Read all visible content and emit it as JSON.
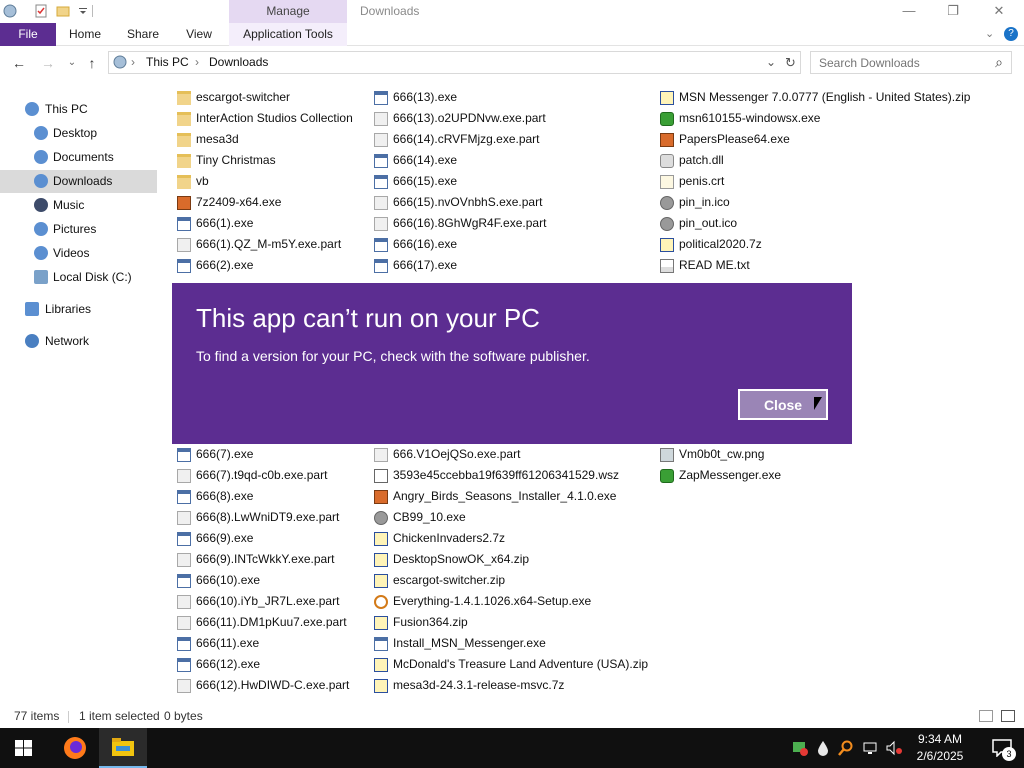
{
  "window": {
    "title": "Downloads",
    "manage_tab": "Manage",
    "minimize_glyph": "—",
    "maximize_glyph": "❐",
    "close_glyph": "✕"
  },
  "ribbon": {
    "file": "File",
    "home": "Home",
    "share": "Share",
    "view": "View",
    "app_tools": "Application Tools",
    "collapse_glyph": "⌄",
    "help_glyph": "?"
  },
  "address": {
    "back_glyph": "←",
    "forward_glyph": "→",
    "recent_glyph": "⌄",
    "up_glyph": "↑",
    "crumbs": [
      "This PC",
      "Downloads"
    ],
    "separator": "›",
    "dropdown_glyph": "⌄",
    "refresh_glyph": "↻",
    "search_placeholder": "Search Downloads",
    "search_glyph": "⌕"
  },
  "nav": {
    "items": [
      {
        "label": "This PC",
        "icon": "this-pc-icon",
        "color": "#5b8fd1"
      },
      {
        "label": "Desktop",
        "icon": "desktop-icon",
        "color": "#5b8fd1"
      },
      {
        "label": "Documents",
        "icon": "documents-icon",
        "color": "#5b8fd1"
      },
      {
        "label": "Downloads",
        "icon": "downloads-icon",
        "color": "#5b8fd1"
      },
      {
        "label": "Music",
        "icon": "music-icon",
        "color": "#3d4b6a"
      },
      {
        "label": "Pictures",
        "icon": "pictures-icon",
        "color": "#5b8fd1"
      },
      {
        "label": "Videos",
        "icon": "videos-icon",
        "color": "#5b8fd1"
      },
      {
        "label": "Local Disk (C:)",
        "icon": "local-disk-icon",
        "color": "#7aa1c9"
      },
      {
        "label": "Libraries",
        "icon": "libraries-icon",
        "color": "#5b8fd1"
      },
      {
        "label": "Network",
        "icon": "network-icon",
        "color": "#4a7fc1"
      }
    ]
  },
  "files": {
    "col1": [
      {
        "name": "escargot-switcher",
        "type": "folder"
      },
      {
        "name": "InterAction Studios Collection",
        "type": "folder"
      },
      {
        "name": "mesa3d",
        "type": "folder"
      },
      {
        "name": "Tiny Christmas",
        "type": "folder"
      },
      {
        "name": "vb",
        "type": "folder"
      },
      {
        "name": "7z2409-x64.exe",
        "type": "special"
      },
      {
        "name": "666(1).exe",
        "type": "exe"
      },
      {
        "name": "666(1).QZ_M-m5Y.exe.part",
        "type": "part"
      },
      {
        "name": "666(2).exe",
        "type": "exe"
      },
      {
        "name": "666(7).exe",
        "type": "exe"
      },
      {
        "name": "666(7).t9qd-c0b.exe.part",
        "type": "part"
      },
      {
        "name": "666(8).exe",
        "type": "exe"
      },
      {
        "name": "666(8).LwWniDT9.exe.part",
        "type": "part"
      },
      {
        "name": "666(9).exe",
        "type": "exe"
      },
      {
        "name": "666(9).INTcWkkY.exe.part",
        "type": "part"
      },
      {
        "name": "666(10).exe",
        "type": "exe"
      },
      {
        "name": "666(10).iYb_JR7L.exe.part",
        "type": "part"
      },
      {
        "name": "666(11).DM1pKuu7.exe.part",
        "type": "part"
      },
      {
        "name": "666(11).exe",
        "type": "exe"
      },
      {
        "name": "666(12).exe",
        "type": "exe"
      },
      {
        "name": "666(12).HwDIWD-C.exe.part",
        "type": "part"
      }
    ],
    "col2": [
      {
        "name": "666(13).exe",
        "type": "exe"
      },
      {
        "name": "666(13).o2UPDNvw.exe.part",
        "type": "part"
      },
      {
        "name": "666(14).cRVFMjzg.exe.part",
        "type": "part"
      },
      {
        "name": "666(14).exe",
        "type": "exe"
      },
      {
        "name": "666(15).exe",
        "type": "exe"
      },
      {
        "name": "666(15).nvOVnbhS.exe.part",
        "type": "part"
      },
      {
        "name": "666(16).8GhWgR4F.exe.part",
        "type": "part"
      },
      {
        "name": "666(16).exe",
        "type": "exe"
      },
      {
        "name": "666(17).exe",
        "type": "exe"
      },
      {
        "name": "666.V1OejQSo.exe.part",
        "type": "part"
      },
      {
        "name": "3593e45ccebba19f639ff61206341529.wsz",
        "type": "wsz"
      },
      {
        "name": "Angry_Birds_Seasons_Installer_4.1.0.exe",
        "type": "special"
      },
      {
        "name": "CB99_10.exe",
        "type": "ico"
      },
      {
        "name": "ChickenInvaders2.7z",
        "type": "zip"
      },
      {
        "name": "DesktopSnowOK_x64.zip",
        "type": "zip"
      },
      {
        "name": "escargot-switcher.zip",
        "type": "zip"
      },
      {
        "name": "Everything-1.4.1.1026.x64-Setup.exe",
        "type": "search"
      },
      {
        "name": "Fusion364.zip",
        "type": "zip"
      },
      {
        "name": "Install_MSN_Messenger.exe",
        "type": "exe"
      },
      {
        "name": "McDonald's Treasure Land Adventure (USA).zip",
        "type": "zip"
      },
      {
        "name": "mesa3d-24.3.1-release-msvc.7z",
        "type": "zip"
      }
    ],
    "col3": [
      {
        "name": "MSN Messenger 7.0.0777 (English - United States).zip",
        "type": "zip"
      },
      {
        "name": "msn610155-windowsx.exe",
        "type": "msn"
      },
      {
        "name": "PapersPlease64.exe",
        "type": "special"
      },
      {
        "name": "patch.dll",
        "type": "dll"
      },
      {
        "name": "penis.crt",
        "type": "crt"
      },
      {
        "name": "pin_in.ico",
        "type": "ico"
      },
      {
        "name": "pin_out.ico",
        "type": "ico"
      },
      {
        "name": "political2020.7z",
        "type": "zip"
      },
      {
        "name": "READ ME.txt",
        "type": "txt"
      },
      {
        "name": "Vm0b0t_cw.png",
        "type": "png"
      },
      {
        "name": "ZapMessenger.exe",
        "type": "msn"
      }
    ]
  },
  "status": {
    "count": "77 items",
    "selected": "1 item selected",
    "size": "0 bytes"
  },
  "dialog": {
    "title": "This app can’t run on your PC",
    "message": "To find a version for your PC, check with the software publisher.",
    "close": "Close"
  },
  "taskbar": {
    "time": "9:34 AM",
    "date": "2/6/2025",
    "notifications": "3",
    "tray_icons": [
      "security-icon",
      "water-drop-icon",
      "everything-icon",
      "network-tray-icon",
      "volume-muted-icon"
    ]
  },
  "colors": {
    "accent": "#5c2d91",
    "dialog_bg": "#5c2d91",
    "selected_nav": "#dadada",
    "taskbar": "#101010"
  }
}
